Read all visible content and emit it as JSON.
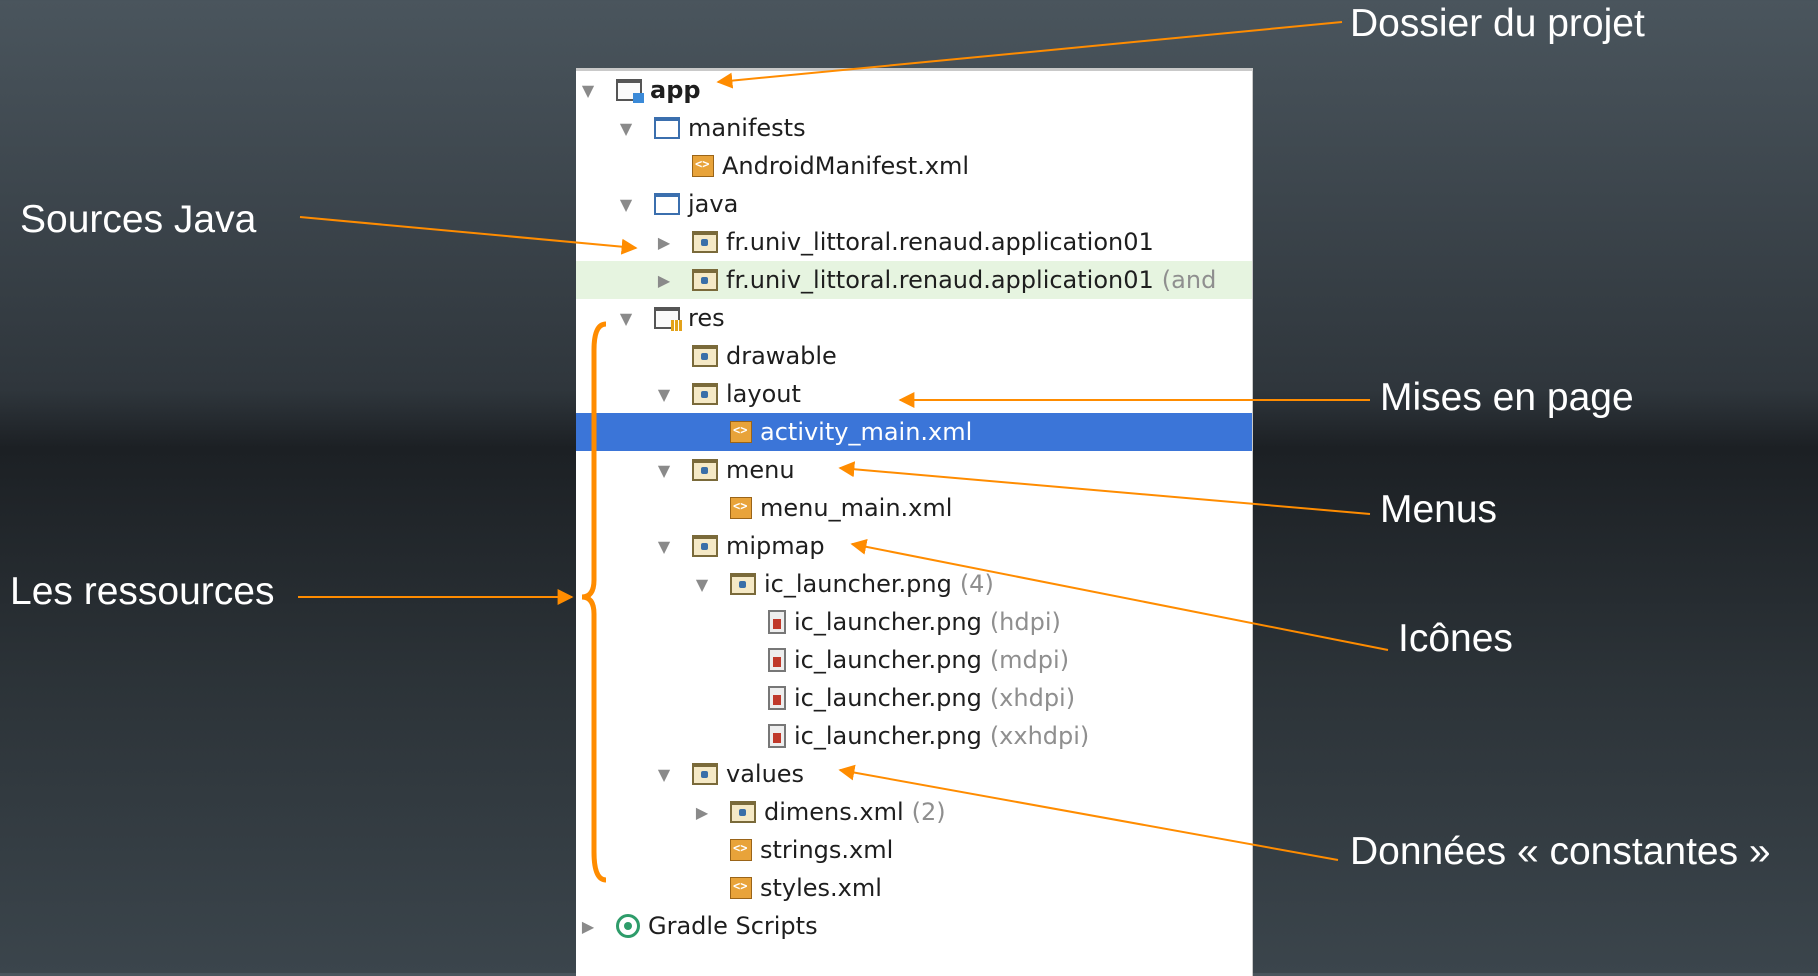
{
  "tree": {
    "items": [
      {
        "label": "app",
        "bold": true,
        "hint": "",
        "arrow": "down"
      },
      {
        "label": "manifests",
        "hint": "",
        "arrow": "down"
      },
      {
        "label": "AndroidManifest.xml",
        "hint": "",
        "arrow": "none"
      },
      {
        "label": "java",
        "hint": "",
        "arrow": "down"
      },
      {
        "label": "fr.univ_littoral.renaud.application01",
        "hint": "",
        "arrow": "right"
      },
      {
        "label": "fr.univ_littoral.renaud.application01",
        "hint": "(and",
        "arrow": "right"
      },
      {
        "label": "res",
        "hint": "",
        "arrow": "down"
      },
      {
        "label": "drawable",
        "hint": "",
        "arrow": "none"
      },
      {
        "label": "layout",
        "hint": "",
        "arrow": "down"
      },
      {
        "label": "activity_main.xml",
        "hint": "",
        "arrow": "none"
      },
      {
        "label": "menu",
        "hint": "",
        "arrow": "down"
      },
      {
        "label": "menu_main.xml",
        "hint": "",
        "arrow": "none"
      },
      {
        "label": "mipmap",
        "hint": "",
        "arrow": "down"
      },
      {
        "label": "ic_launcher.png",
        "hint": "(4)",
        "arrow": "down"
      },
      {
        "label": "ic_launcher.png",
        "hint": "(hdpi)",
        "arrow": "none"
      },
      {
        "label": "ic_launcher.png",
        "hint": "(mdpi)",
        "arrow": "none"
      },
      {
        "label": "ic_launcher.png",
        "hint": "(xhdpi)",
        "arrow": "none"
      },
      {
        "label": "ic_launcher.png",
        "hint": "(xxhdpi)",
        "arrow": "none"
      },
      {
        "label": "values",
        "hint": "",
        "arrow": "down"
      },
      {
        "label": "dimens.xml",
        "hint": "(2)",
        "arrow": "right"
      },
      {
        "label": "strings.xml",
        "hint": "",
        "arrow": "none"
      },
      {
        "label": "styles.xml",
        "hint": "",
        "arrow": "none"
      },
      {
        "label": "Gradle Scripts",
        "hint": "",
        "arrow": "right"
      }
    ]
  },
  "annotations": {
    "project_folder": "Dossier du projet",
    "java_sources": "Sources Java",
    "layouts": "Mises en page",
    "menus": "Menus",
    "icons": "Icônes",
    "resources": "Les ressources",
    "constants": "Données « constantes »"
  },
  "colors": {
    "accent_annotation": "#ff8c00",
    "selection": "#3b75d8",
    "hint_text": "#8f8f8f"
  }
}
